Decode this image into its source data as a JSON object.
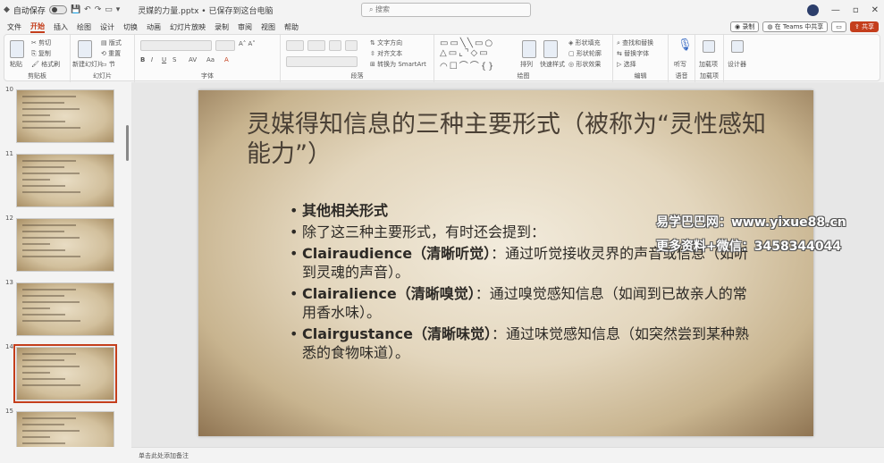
{
  "titlebar": {
    "autosave_label": "自动保存",
    "file_title": "灵媒的力量.pptx • 已保存到这台电脑",
    "search_placeholder": "搜索"
  },
  "menu": {
    "tabs": [
      "文件",
      "开始",
      "插入",
      "绘图",
      "设计",
      "切换",
      "动画",
      "幻灯片放映",
      "录制",
      "审阅",
      "视图",
      "帮助"
    ],
    "active": "开始",
    "right": {
      "record": "录制",
      "teams": "在 Teams 中共享",
      "share": "共享"
    }
  },
  "ribbon": {
    "clipboard": {
      "paste": "粘贴",
      "cut": "剪切",
      "copy": "复制",
      "format_painter": "格式刷",
      "label": "剪贴板"
    },
    "slides": {
      "new_slide": "新建幻灯片",
      "layout": "版式",
      "reset": "重置",
      "section": "节",
      "label": "幻灯片"
    },
    "font": {
      "label": "字体"
    },
    "paragraph": {
      "text_direction": "文字方向",
      "align_text": "对齐文本",
      "smartart": "转换为 SmartArt",
      "label": "段落"
    },
    "drawing": {
      "arrange": "排列",
      "quick_styles": "快速样式",
      "shape_fill": "形状填充",
      "shape_outline": "形状轮廓",
      "shape_effects": "形状效果",
      "label": "绘图"
    },
    "editing": {
      "find": "查找和替换",
      "replace": "替换字体",
      "select": "选择",
      "label": "编辑"
    },
    "voice": {
      "dictate": "听写",
      "label": "语音"
    },
    "addins": {
      "addins": "加载项",
      "label": "加载项"
    },
    "designer": {
      "label": "设计器"
    }
  },
  "thumbnails": [
    {
      "num": "10",
      "selected": false
    },
    {
      "num": "11",
      "selected": false
    },
    {
      "num": "12",
      "selected": false
    },
    {
      "num": "13",
      "selected": false
    },
    {
      "num": "14",
      "selected": true
    },
    {
      "num": "15",
      "selected": false
    }
  ],
  "slide": {
    "title": "灵媒得知信息的三种主要形式（被称为“灵性感知能力”）",
    "bullets": [
      {
        "bold": "其他相关形式",
        "text": ""
      },
      {
        "bold": "",
        "text": "除了这三种主要形式，有时还会提到："
      },
      {
        "bold": "Clairaudience（清晰听觉）",
        "text": "：通过听觉接收灵界的声音或信息（如听到灵魂的声音）。"
      },
      {
        "bold": "Clairalience（清晰嗅觉）",
        "text": "：通过嗅觉感知信息（如闻到已故亲人的常用香水味）。"
      },
      {
        "bold": "Clairgustance（清晰味觉）",
        "text": "：通过味觉感知信息（如突然尝到某种熟悉的食物味道）。"
      }
    ]
  },
  "watermark": {
    "line1": "易学巴巴网：www.yixue88.cn",
    "line2": "更多资料+微信：3458344044"
  },
  "notes_placeholder": "单击此处添加备注"
}
